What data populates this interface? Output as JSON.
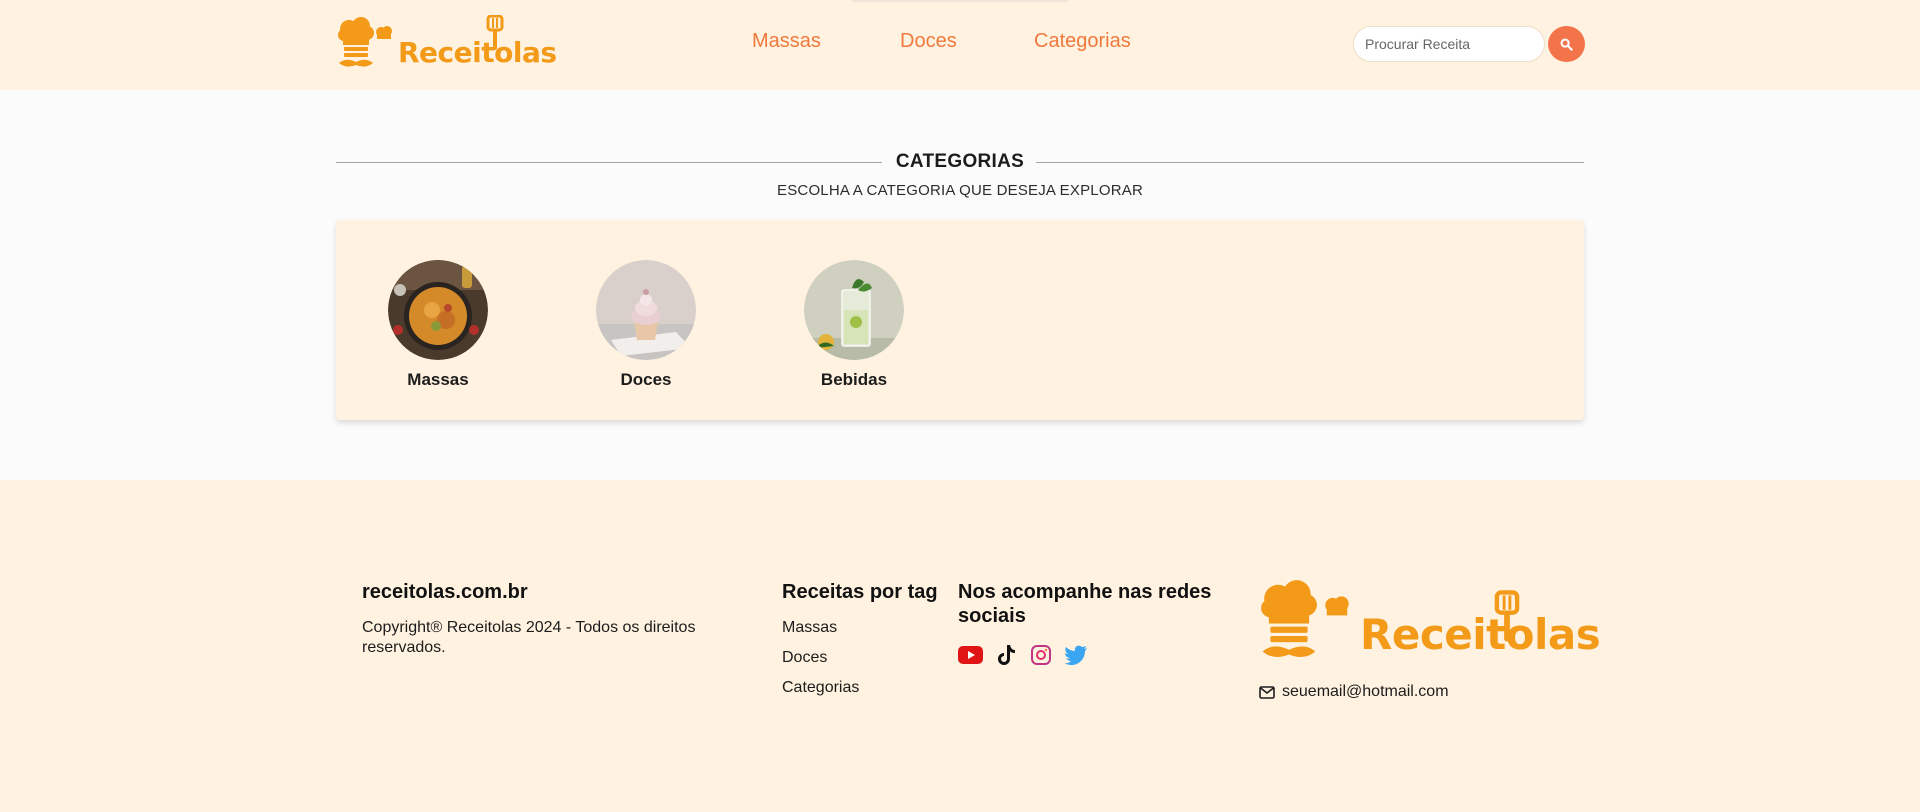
{
  "header": {
    "logo_text": "Receitolas",
    "nav": [
      {
        "label": "Massas"
      },
      {
        "label": "Doces"
      },
      {
        "label": "Categorias"
      }
    ],
    "search": {
      "placeholder": "Procurar Receita",
      "value": ""
    },
    "search_icon": "search-icon"
  },
  "main": {
    "title": "CATEGORIAS",
    "subtitle": "ESCOLHA A CATEGORIA QUE DESEJA EXPLORAR",
    "categories": [
      {
        "name": "Massas"
      },
      {
        "name": "Doces"
      },
      {
        "name": "Bebidas"
      }
    ]
  },
  "footer": {
    "site": "receitolas.com.br",
    "copyright": "Copyright® Receitolas 2024 - Todos os direitos reservados.",
    "tags_heading": "Receitas por tag",
    "tags": [
      {
        "label": "Massas"
      },
      {
        "label": "Doces"
      },
      {
        "label": "Categorias"
      }
    ],
    "social_heading": "Nos acompanhe nas redes sociais",
    "social_icons": [
      "youtube-icon",
      "tiktok-icon",
      "instagram-icon",
      "twitter-icon"
    ],
    "logo_text": "Receitolas",
    "email": "seuemail@hotmail.com"
  },
  "colors": {
    "accent": "#f3734a",
    "brand": "#f39a18",
    "cream": "#fff2e0",
    "nav_link": "#ef7a3c"
  }
}
